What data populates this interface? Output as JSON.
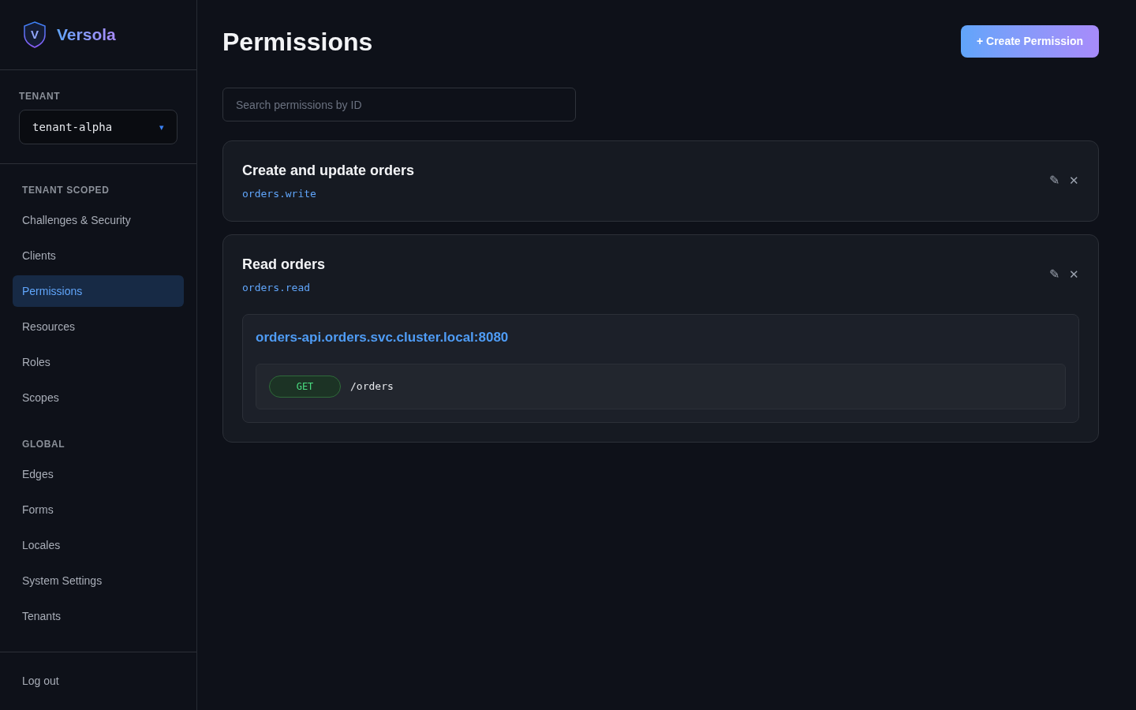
{
  "brand": {
    "logo_letter": "V",
    "name": "Versola"
  },
  "tenant": {
    "label": "TENANT",
    "value": "tenant-alpha",
    "caret": "▾"
  },
  "sidebar": {
    "sections": [
      {
        "title": "TENANT SCOPED",
        "items": [
          {
            "label": "Challenges & Security",
            "selected": false
          },
          {
            "label": "Clients",
            "selected": false
          },
          {
            "label": "Permissions",
            "selected": true
          },
          {
            "label": "Resources",
            "selected": false
          },
          {
            "label": "Roles",
            "selected": false
          },
          {
            "label": "Scopes",
            "selected": false
          }
        ]
      },
      {
        "title": "GLOBAL",
        "items": [
          {
            "label": "Edges",
            "selected": false
          },
          {
            "label": "Forms",
            "selected": false
          },
          {
            "label": "Locales",
            "selected": false
          },
          {
            "label": "System Settings",
            "selected": false
          },
          {
            "label": "Tenants",
            "selected": false
          }
        ]
      }
    ],
    "footer": "Log out"
  },
  "page": {
    "title": "Permissions",
    "create_button": "+ Create Permission",
    "search": {
      "placeholder": "Search permissions by ID"
    }
  },
  "permissions": [
    {
      "title": "Create and update orders",
      "id": "orders.write",
      "edit": "✎",
      "delete": "✕"
    },
    {
      "title": "Read orders",
      "id": "orders.read",
      "edit": "✎",
      "delete": "✕",
      "resources": [
        {
          "host": "orders-api.orders.svc.cluster.local:8080",
          "endpoints": [
            {
              "method": "GET",
              "path": "/orders"
            }
          ]
        }
      ]
    }
  ]
}
